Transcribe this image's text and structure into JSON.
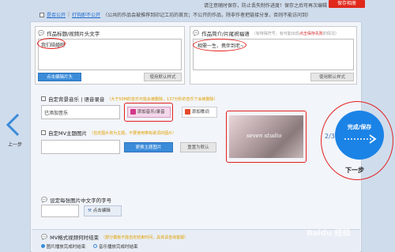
{
  "top": {
    "notice": "请注意随时保存，防止丢失制作进度！保存之后可再次编辑",
    "save_label": "保存相册",
    "public_label": "是否公开",
    "private_link": "打钩即不公开",
    "public_note": "（公共的作品会被推荐到印记工坊的首页；不公开的作品，除非作者把链接分享，否则不能访问到）"
  },
  "title_section": {
    "title": "作品标题/视频片头文字",
    "value": "我们结婚吧",
    "button": "点击编辑片头"
  },
  "intro_section": {
    "title": "作品简介/片尾祝福语",
    "hint": "（有特殊符号，有可能出现",
    "hint_red": "点击保存失败",
    "hint_end": "的情况）",
    "value": "相需一生，携伴到老~",
    "button": "使用默认样式"
  },
  "music_section": {
    "title": "自定背景音乐 | 语音录音",
    "hint": "（大于50M的音乐可能会被删除，137分秒的音乐下会被删除）",
    "value": "已添加音乐",
    "add_button": "添加音乐/录音",
    "lyrics_button": "添加歌词"
  },
  "theme_section": {
    "title": "自定MV主题图片",
    "hint": "（自定图片将为主题，不要使用带有歌词的图片）",
    "change_button": "更换主题图片",
    "reset_button": "重置为默认",
    "preview_text": "seven studio"
  },
  "font_section": {
    "title": "设定每张图片中文字的字号",
    "edit_button": "点击编辑"
  },
  "end_section": {
    "title": "MV格式视频何时结束",
    "hint": "（部分模板不能自定结束时间，具体请咨询客服）",
    "opt1": "图片播放完成时结束",
    "opt2": "音乐播放完成时结束"
  },
  "nav": {
    "prev": "上一步",
    "page": "2/3",
    "complete_line1": "完成/保存",
    "next": "下一步"
  },
  "watermark": "Baidu 经验"
}
